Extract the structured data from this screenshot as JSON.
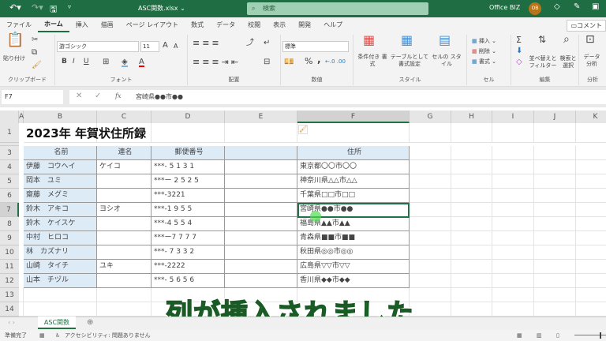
{
  "titlebar": {
    "file": "ASC関数.xlsx ⌄",
    "search": "検索",
    "account": "Office BIZ",
    "avatar": "OB"
  },
  "menu": [
    "ファイル",
    "ホーム",
    "挿入",
    "描画",
    "ページ レイアウト",
    "数式",
    "データ",
    "校閲",
    "表示",
    "開発",
    "ヘルプ"
  ],
  "comment_button": "コメント",
  "ribbon": {
    "clipboard": {
      "paste": "貼り付け",
      "label": "クリップボード"
    },
    "font": {
      "name": "游ゴシック",
      "size": "11",
      "label": "フォント",
      "bold": "B",
      "italic": "I",
      "underline": "U"
    },
    "alignment": {
      "label": "配置"
    },
    "number": {
      "format": "標準",
      "label": "数値",
      "percent": "%",
      "comma": ","
    },
    "styles": {
      "conditional": "条件付き 書式",
      "table": "テーブルとして 書式設定",
      "cell": "セルの スタイル",
      "label": "スタイル"
    },
    "cells": {
      "insert": "挿入",
      "delete": "削除",
      "format": "書式",
      "label": "セル"
    },
    "editing": {
      "sort": "並べ替えと フィルター",
      "find": "検索と 選択",
      "label": "編集"
    },
    "analysis": {
      "data": "データ 分析",
      "label": "分析"
    }
  },
  "formula_bar": {
    "name_box": "F7",
    "fx": "fx",
    "value": "宮崎県●●市●●"
  },
  "columns": [
    "A",
    "B",
    "C",
    "D",
    "E",
    "F",
    "G",
    "H",
    "I",
    "J",
    "K"
  ],
  "rows": [
    "1",
    "3",
    "4",
    "5",
    "6",
    "7",
    "8",
    "9",
    "10",
    "11",
    "12",
    "13",
    "14"
  ],
  "sheet": {
    "title": "2023年 年賀状住所録",
    "headers": [
      "名前",
      "連名",
      "郵便番号",
      "",
      "住所"
    ],
    "records": [
      [
        "伊藤　コウヘイ",
        "ケイコ",
        "***- 5 1 3 1",
        "",
        "東京都〇〇市〇〇"
      ],
      [
        "岡本　ユミ",
        "",
        "***ー 2 5 2 5",
        "",
        "神奈川県△△市△△"
      ],
      [
        "齋藤　メグミ",
        "",
        "***-3221",
        "",
        "千葉県□□市□□"
      ],
      [
        "鈴木　アキコ",
        "ヨシオ",
        "***-1 9 5 5",
        "",
        "宮崎県●●市●●"
      ],
      [
        "鈴木　ケイスケ",
        "",
        "***-4 5 5 4",
        "",
        "福島県▲▲市▲▲"
      ],
      [
        "中村　ヒロコ",
        "",
        "***ー7 7 7 7",
        "",
        "青森県■■市■■"
      ],
      [
        "林　カズナリ",
        "",
        "***- 7 3 3 2",
        "",
        "秋田県◎◎市◎◎"
      ],
      [
        "山崎　タイチ",
        "ユキ",
        "***-2222",
        "",
        "広島県▽▽市▽▽"
      ],
      [
        "山本　チヅル",
        "",
        "***- 5 6 5 6",
        "",
        "香川県◆◆市◆◆"
      ]
    ]
  },
  "sheet_tab": "ASC関数",
  "status": {
    "ready": "準備完了",
    "accessibility": "アクセシビリティ: 問題ありません"
  },
  "caption": "列が挿入されました",
  "colors": {
    "accent": "#217346",
    "header_fill": "#ddebf7"
  }
}
